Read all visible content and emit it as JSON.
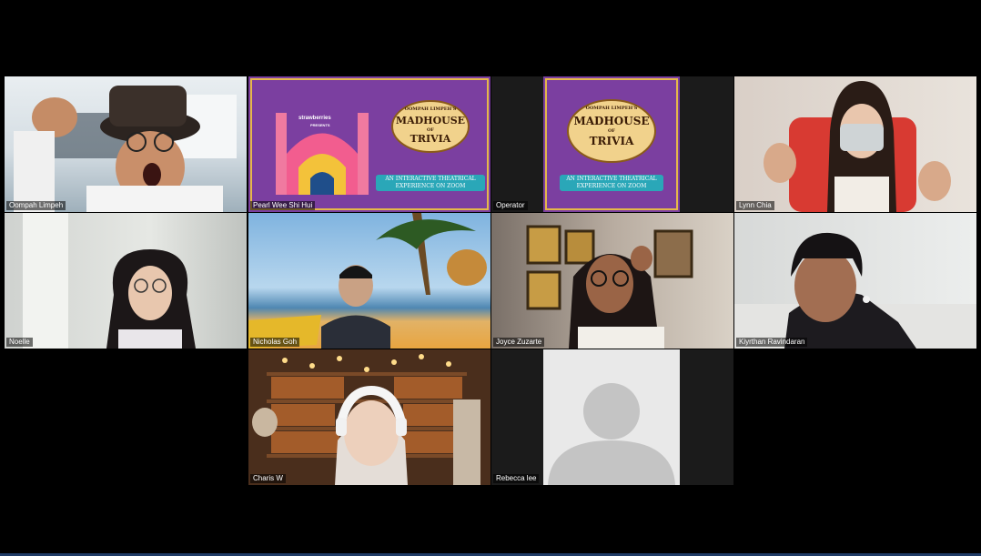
{
  "participants": [
    {
      "name": "Oompah Limpeh"
    },
    {
      "name": "Pearl Wee Shi Hui"
    },
    {
      "name": "Operator"
    },
    {
      "name": "Lynn Chia"
    },
    {
      "name": "Noelle"
    },
    {
      "name": "Nicholas Goh"
    },
    {
      "name": "Joyce Zuzarte"
    },
    {
      "name": "Kiyrthan Ravindaran"
    },
    {
      "name": "Charis W"
    },
    {
      "name": "Rebecca lee"
    }
  ],
  "shared_poster": {
    "brand": "strawberries",
    "presents": "PRESENTS",
    "title_top": "OOMPAH LIMPEH'S",
    "title_main": "MADHOUSE",
    "title_of": "OF",
    "title_trivia": "TRIVIA",
    "tagline_1": "AN INTERACTIVE THEATRICAL",
    "tagline_2": "EXPERIENCE ON ZOOM"
  },
  "colors": {
    "background": "#000000",
    "poster_purple": "#7b3fa0",
    "label_bg": "rgba(0,0,0,0.55)",
    "banner_teal": "#2aa7b8"
  }
}
